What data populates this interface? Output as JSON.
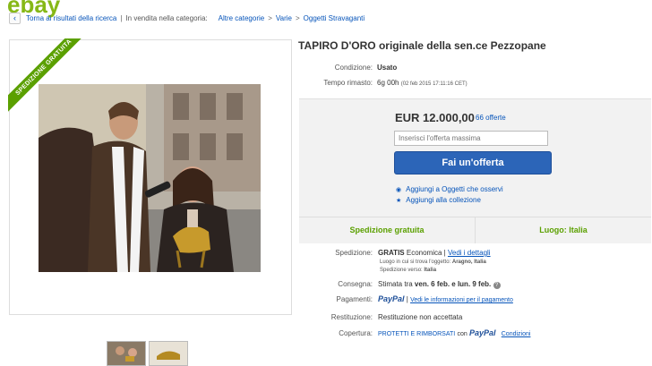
{
  "header": {
    "back_icon": "‹",
    "back_link": "Torna ai risultati della ricerca",
    "category_label": "In vendita nella categoria:",
    "crumbs": [
      "Altre categorie",
      "Varie",
      "Oggetti Stravaganti"
    ]
  },
  "listing": {
    "title": "TAPIRO D'ORO originale della sen.ce Pezzopane",
    "ribbon": "SPEDIZIONE GRATUITA",
    "condition_label": "Condizione:",
    "condition_value": "Usato",
    "time_label": "Tempo rimasto:",
    "time_value": "6g 00h",
    "time_date": "(02 feb 2015   17:11:16 CET)"
  },
  "bid": {
    "price": "EUR 12.000,00",
    "offers": "66 offerte",
    "input_placeholder": "Inserisci l'offerta massima",
    "button": "Fai un'offerta",
    "watch": "Aggiungi a Oggetti che osservi",
    "collection": "Aggiungi alla collezione",
    "shipping_free": "Spedizione gratuita",
    "location": "Luogo: Italia"
  },
  "shipping": {
    "label": "Spedizione:",
    "value_bold": "GRATIS",
    "value": "Economica",
    "details_link": "Vedi i dettagli",
    "located_label": "Luogo in cui si trova l'oggetto:",
    "located_value": "Aragno, Italia",
    "to_label": "Spedizione verso:",
    "to_value": "Italia"
  },
  "delivery": {
    "label": "Consegna:",
    "prefix": "Stimata tra",
    "range": "ven. 6 feb. e lun. 9 feb."
  },
  "payments": {
    "label": "Pagamenti:",
    "paypal": "PayPal",
    "link": "Vedi le informazioni per il pagamento"
  },
  "returns": {
    "label": "Restituzione:",
    "value": "Restituzione non accettata"
  },
  "coverage": {
    "label": "Copertura:",
    "value": "PROTETTI E RIMBORSATI",
    "with": "con",
    "paypal": "PayPal",
    "link": "Condizioni"
  }
}
